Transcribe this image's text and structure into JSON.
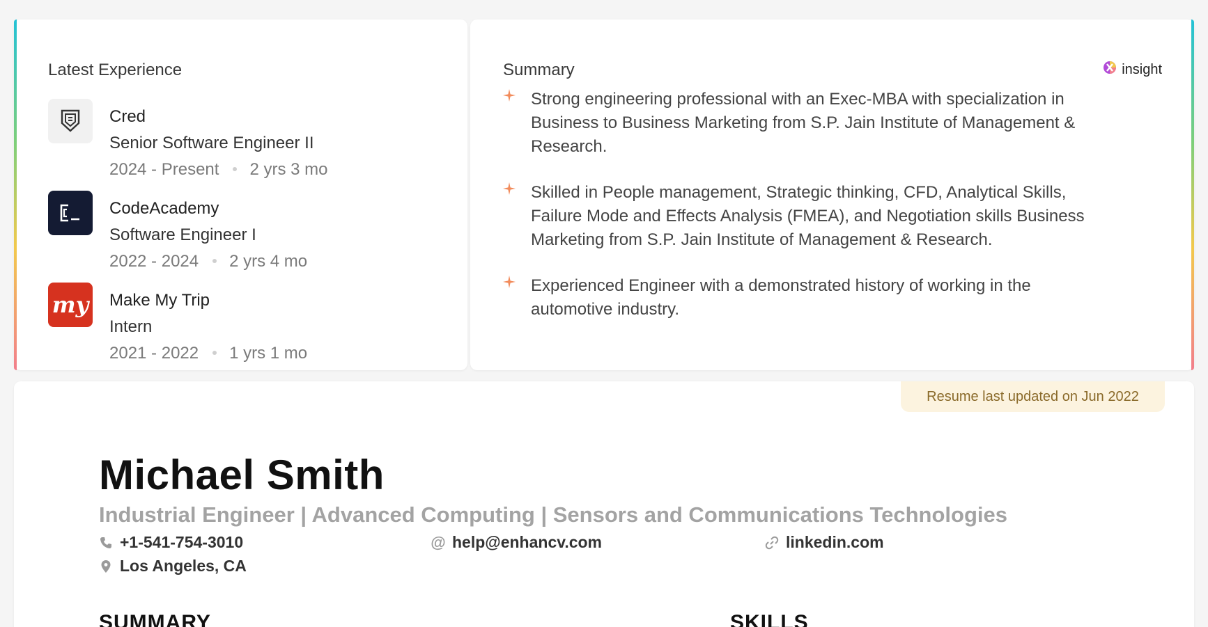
{
  "experience": {
    "title": "Latest Experience",
    "items": [
      {
        "company": "Cred",
        "role": "Senior Software Engineer II",
        "period": "2024 - Present",
        "duration": "2 yrs 3 mo",
        "logo": "cred-logo"
      },
      {
        "company": "CodeAcademy",
        "role": "Software Engineer I",
        "period": "2022 - 2024",
        "duration": "2 yrs 4 mo",
        "logo": "codeacademy-logo"
      },
      {
        "company": "Make My Trip",
        "role": "Intern",
        "period": "2021 - 2022",
        "duration": "1 yrs 1 mo",
        "logo": "makemytrip-logo",
        "logo_text": "my"
      }
    ]
  },
  "summary": {
    "title": "Summary",
    "brand_label": "insight",
    "bullets": [
      "Strong engineering professional with an Exec-MBA with specialization in Business to Business Marketing from S.P. Jain Institute of Management & Research.",
      "Skilled in People management, Strategic thinking, CFD, Analytical Skills, Failure Mode and Effects Analysis (FMEA), and Negotiation skills Business Marketing from S.P. Jain Institute of Management & Research.",
      "Experienced Engineer with a demonstrated history of working in the automotive industry."
    ]
  },
  "resume": {
    "updated_badge": "Resume last updated on Jun 2022",
    "name": "Michael Smith",
    "headline": "Industrial Engineer | Advanced Computing | Sensors and Communications Technologies",
    "phone": "+1-541-754-3010",
    "email": "help@enhancv.com",
    "website": "linkedin.com",
    "location": "Los Angeles, CA",
    "sections": {
      "summary": "SUMMARY",
      "skills": "SKILLS"
    }
  },
  "colors": {
    "accent_star": "#f28b5b",
    "badge_bg": "#fcf3df",
    "gradient": [
      "#24c2d6",
      "#7dcf7a",
      "#f2c94c",
      "#f27e8c"
    ]
  }
}
